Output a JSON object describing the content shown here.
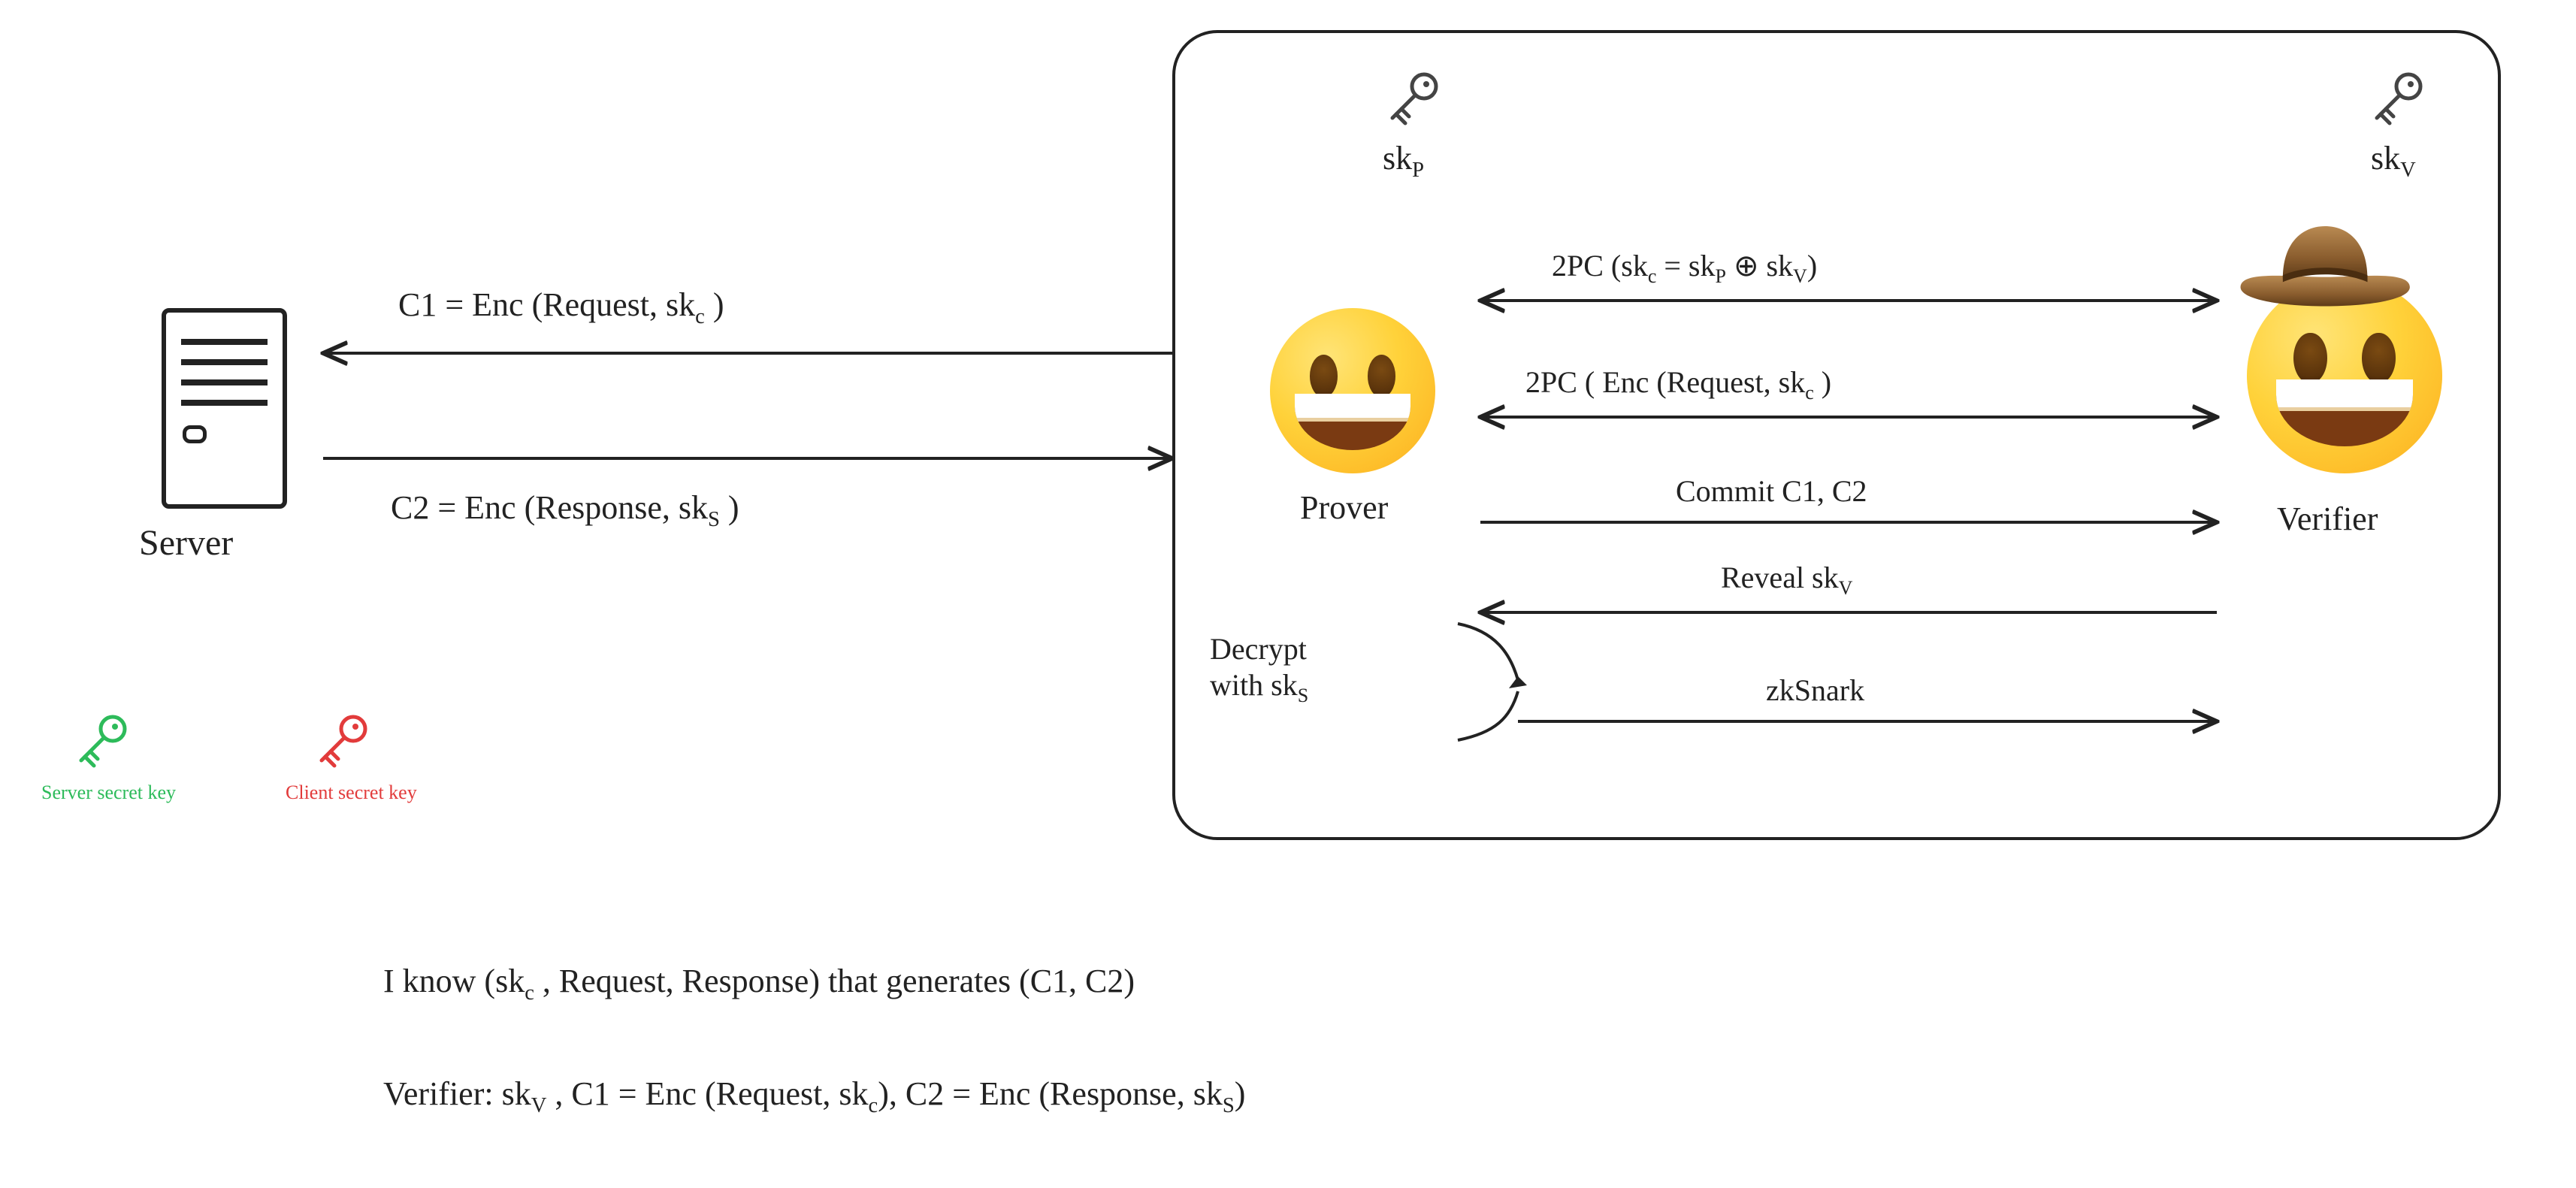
{
  "server": {
    "title": "Server",
    "c1": {
      "pre": "C1 = Enc (Request, sk",
      "sub": "c",
      "post": " )"
    },
    "c2": {
      "pre": "C2 = Enc (Response, sk",
      "sub": "S",
      "post": " )"
    }
  },
  "keys": {
    "server_label": "Server secret key",
    "client_label": "Client secret key",
    "prover": {
      "pre": "sk",
      "sub": "P"
    },
    "verifier": {
      "pre": "sk",
      "sub": "V"
    }
  },
  "actors": {
    "prover": "Prover",
    "verifier": "Verifier"
  },
  "steps": {
    "s1": {
      "pre": "2PC (sk",
      "sub1": "c",
      "mid": " = sk",
      "sub2": "P",
      "mid2": " ⊕ sk",
      "sub3": "V",
      "post": ")"
    },
    "s2": {
      "pre": "2PC ( Enc (Request, sk",
      "sub": "c",
      "post": " )"
    },
    "s3": "Commit C1, C2",
    "s4": {
      "pre": "Reveal sk",
      "sub": "V"
    },
    "s5": "zkSnark",
    "decrypt": {
      "line1": "Decrypt",
      "line2_pre": "with sk",
      "line2_sub": "S"
    }
  },
  "bottom": {
    "line1": {
      "pre": "I know (sk",
      "sub": "c",
      "post": " , Request, Response) that generates (C1, C2)"
    },
    "line2": {
      "pre": "Verifier: sk",
      "sub1": "V",
      "mid": " , C1 = Enc (Request, sk",
      "sub2": "c",
      "mid2": "), C2 = Enc (Response, sk",
      "sub3": "S",
      "post": ")"
    }
  },
  "colors": {
    "server_key": "#2dbb5a",
    "client_key": "#e23b3b"
  }
}
